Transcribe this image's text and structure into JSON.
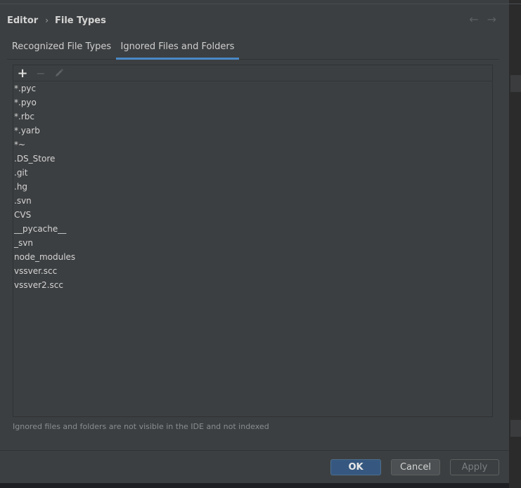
{
  "breadcrumb": {
    "parent": "Editor",
    "separator": "›",
    "current": "File Types"
  },
  "nav": {
    "back_icon": "←",
    "forward_icon": "→"
  },
  "tabs": [
    {
      "label": "Recognized File Types",
      "selected": false
    },
    {
      "label": "Ignored Files and Folders",
      "selected": true
    }
  ],
  "toolbar": {
    "add_icon": "+",
    "remove_icon": "−"
  },
  "ignored_items": [
    "*.pyc",
    "*.pyo",
    "*.rbc",
    "*.yarb",
    "*~",
    ".DS_Store",
    ".git",
    ".hg",
    ".svn",
    "CVS",
    "__pycache__",
    "_svn",
    "node_modules",
    "vssver.scc",
    "vssver2.scc"
  ],
  "hint": "Ignored files and folders are not visible in the IDE and not indexed",
  "buttons": {
    "ok": "OK",
    "cancel": "Cancel",
    "apply": "Apply"
  },
  "colors": {
    "dialog_bg": "#3c3f41",
    "accent": "#4a88c7",
    "ok_button": "#365880"
  }
}
